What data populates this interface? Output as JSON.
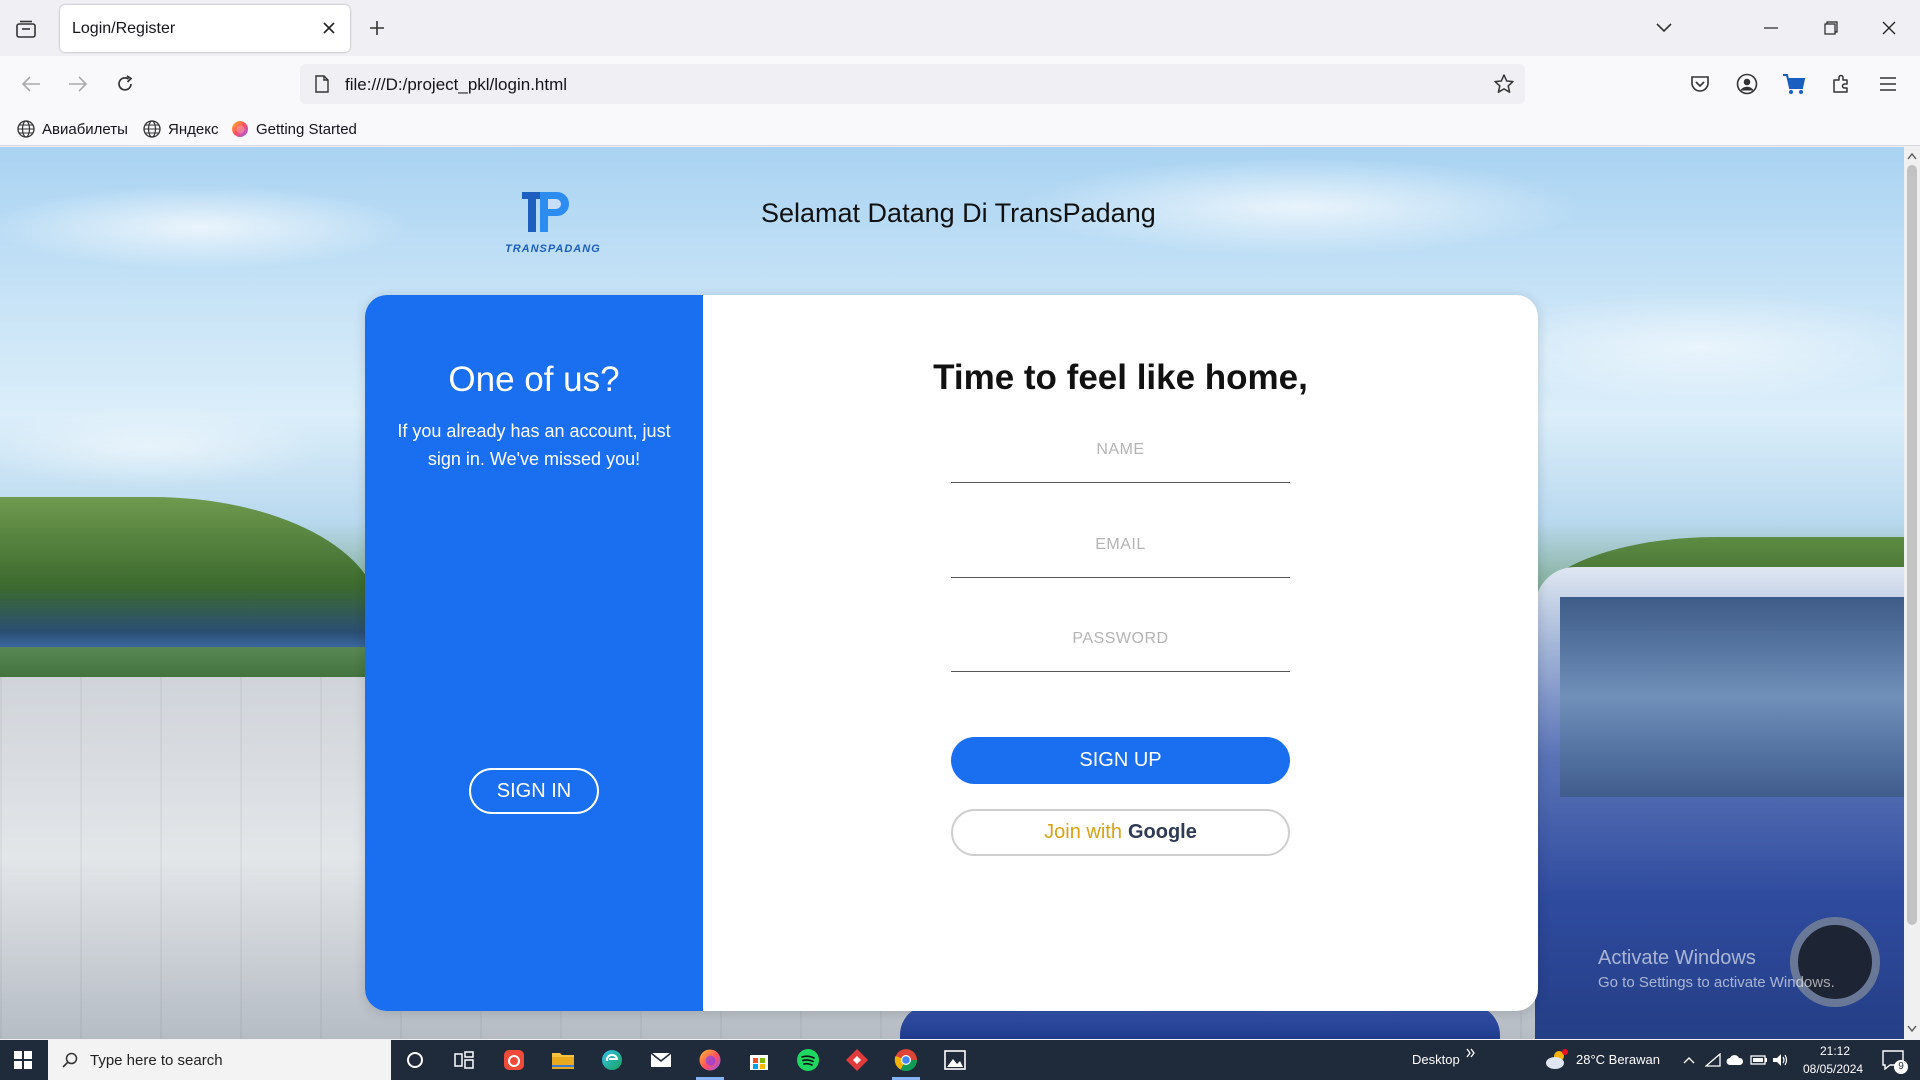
{
  "browser": {
    "tab_title": "Login/Register",
    "url": "file:///D:/project_pkl/login.html",
    "bookmarks": [
      {
        "label": "Авиабилеты",
        "icon": "globe-icon"
      },
      {
        "label": "Яндекс",
        "icon": "globe-icon"
      },
      {
        "label": "Getting Started",
        "icon": "firefox-icon"
      }
    ]
  },
  "page": {
    "logo_text": "TRANSPADANG",
    "welcome": "Selamat Datang Di TransPadang",
    "left_panel": {
      "title": "One of us?",
      "text": "If you already has an account, just sign in. We've missed you!",
      "button": "SIGN IN"
    },
    "form": {
      "title": "Time to feel like home,",
      "name_placeholder": "NAME",
      "email_placeholder": "EMAIL",
      "password_placeholder": "PASSWORD",
      "signup": "SIGN UP",
      "google_prefix": "Join with",
      "google_brand": "Google"
    },
    "watermark": {
      "line1": "Activate Windows",
      "line2": "Go to Settings to activate Windows."
    }
  },
  "taskbar": {
    "search_placeholder": "Type here to search",
    "desktop_label": "Desktop",
    "weather": "28°C  Berawan",
    "time": "21:12",
    "date": "08/05/2024",
    "notification_count": "9"
  },
  "colors": {
    "primary": "#1a6ef0",
    "google_text": "#d9a214"
  }
}
